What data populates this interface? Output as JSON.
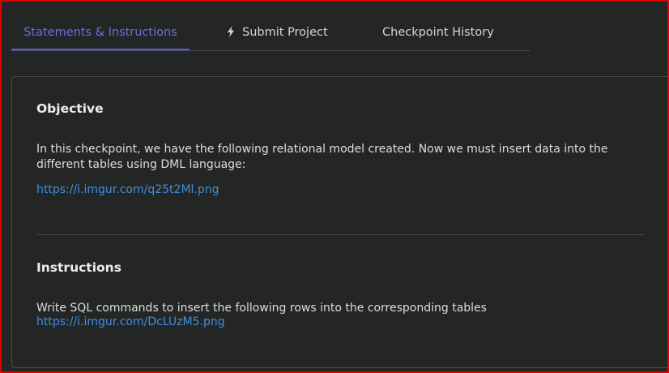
{
  "tabs": [
    {
      "label": "Statements & Instructions",
      "active": true
    },
    {
      "label": "Submit Project",
      "icon": "bolt-icon"
    },
    {
      "label": "Checkpoint History"
    }
  ],
  "objective": {
    "heading": "Objective",
    "text": "In this checkpoint, we have the following relational model created. Now we must insert data into the different tables using DML language:",
    "link": "https://i.imgur.com/q25t2Ml.png"
  },
  "instructions": {
    "heading": "Instructions",
    "text": "Write SQL commands to insert the following rows into the corresponding tables",
    "link": "https://i.imgur.com/DcLUzM5.png"
  },
  "colors": {
    "background": "#242626",
    "active_tab": "#6b6ee0",
    "link": "#3f8fe0",
    "frame_border": "#e00000"
  }
}
